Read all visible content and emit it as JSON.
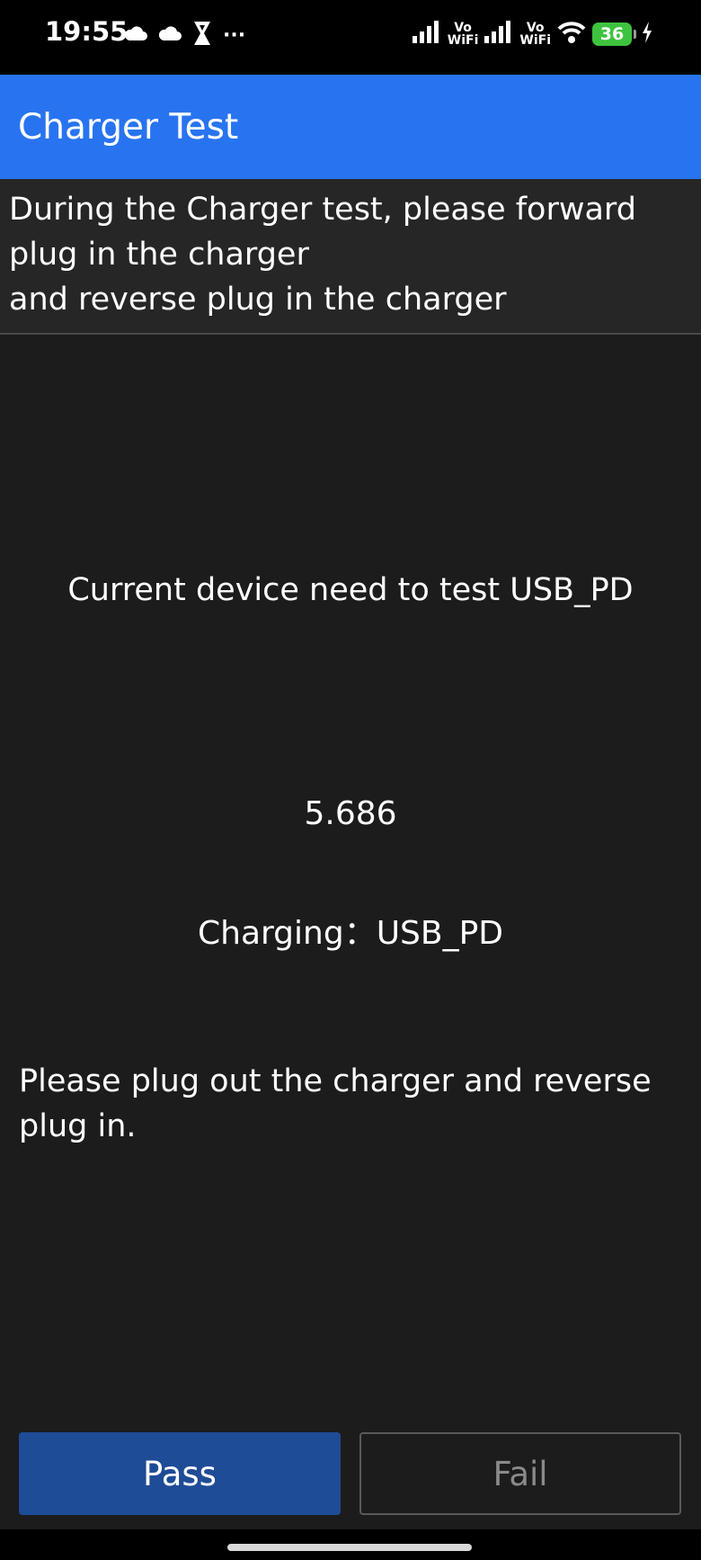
{
  "status_bar": {
    "time": "19:55",
    "vowifi_1_top": "Vo",
    "vowifi_1_bottom": "WiFi",
    "vowifi_2_top": "Vo",
    "vowifi_2_bottom": "WiFi",
    "battery_level": "36",
    "overflow": "···",
    "icons": [
      "cloud-icon",
      "cloud-icon",
      "app-notification-icon",
      "more-icon",
      "signal-icon",
      "vowifi-icon",
      "signal-icon",
      "vowifi-icon",
      "wifi-icon",
      "battery-icon",
      "charging-bolt-icon"
    ]
  },
  "app_bar": {
    "title": "Charger Test"
  },
  "instruction": {
    "line1": "During the Charger test, please forward",
    "line2": "plug in the charger",
    "line3": "and reverse plug in the charger"
  },
  "main": {
    "device_test": "Current device need to test USB_PD",
    "reading": "5.686",
    "charging_status": "Charging：USB_PD",
    "prompt_line1": "Please plug out the charger and reverse",
    "prompt_line2": "plug in."
  },
  "buttons": {
    "pass_label": "Pass",
    "fail_label": "Fail"
  },
  "colors": {
    "app_bar": "#2874f0",
    "background": "#1c1c1c",
    "pass_button": "#1f4c96",
    "battery": "#3ec33e"
  }
}
